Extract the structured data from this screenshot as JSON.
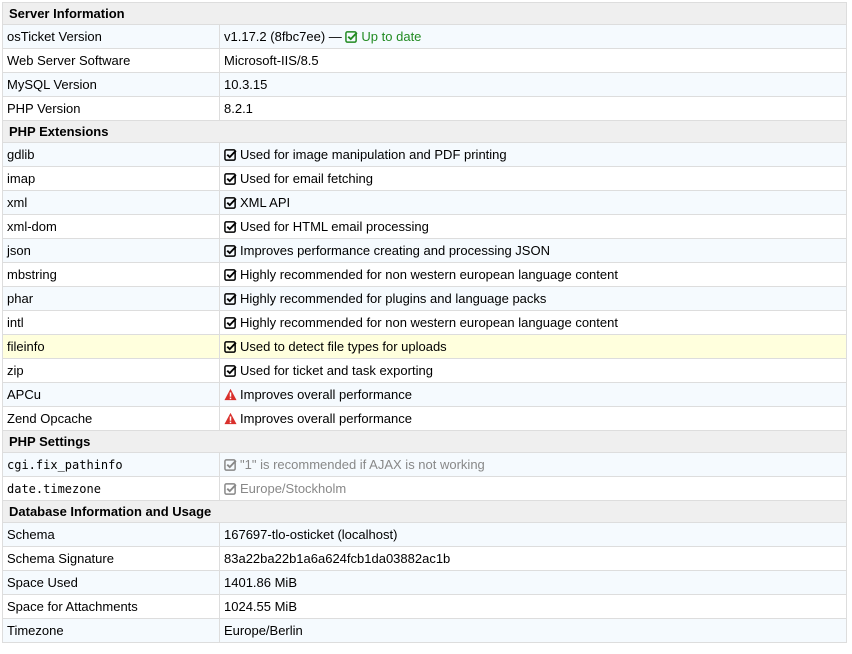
{
  "sections": {
    "server": {
      "title": "Server Information",
      "rows": [
        {
          "label": "osTicket Version",
          "value": "v1.17.2 (8fbc7ee) —",
          "status": "Up to date"
        },
        {
          "label": "Web Server Software",
          "value": "Microsoft-IIS/8.5"
        },
        {
          "label": "MySQL Version",
          "value": "10.3.15"
        },
        {
          "label": "PHP Version",
          "value": "8.2.1"
        }
      ]
    },
    "extensions": {
      "title": "PHP Extensions",
      "rows": [
        {
          "label": "gdlib",
          "value": "Used for image manipulation and PDF printing",
          "icon": "check-square-icon"
        },
        {
          "label": "imap",
          "value": "Used for email fetching",
          "icon": "check-square-icon"
        },
        {
          "label": "xml",
          "value": "XML API",
          "icon": "check-square-icon"
        },
        {
          "label": "xml-dom",
          "value": "Used for HTML email processing",
          "icon": "check-square-icon"
        },
        {
          "label": "json",
          "value": "Improves performance creating and processing JSON",
          "icon": "check-square-icon"
        },
        {
          "label": "mbstring",
          "value": "Highly recommended for non western european language content",
          "icon": "check-square-icon"
        },
        {
          "label": "phar",
          "value": "Highly recommended for plugins and language packs",
          "icon": "check-square-icon"
        },
        {
          "label": "intl",
          "value": "Highly recommended for non western european language content",
          "icon": "check-square-icon"
        },
        {
          "label": "fileinfo",
          "value": "Used to detect file types for uploads",
          "icon": "check-square-icon"
        },
        {
          "label": "zip",
          "value": "Used for ticket and task exporting",
          "icon": "check-square-icon"
        },
        {
          "label": "APCu",
          "value": "Improves overall performance",
          "icon": "warning-icon"
        },
        {
          "label": "Zend Opcache",
          "value": "Improves overall performance",
          "icon": "warning-icon"
        }
      ]
    },
    "settings": {
      "title": "PHP Settings",
      "rows": [
        {
          "label": "cgi.fix_pathinfo",
          "value": "\"1\" is recommended if AJAX is not working",
          "icon": "check-square-icon"
        },
        {
          "label": "date.timezone",
          "value": "Europe/Stockholm",
          "icon": "check-square-icon"
        }
      ]
    },
    "database": {
      "title": "Database Information and Usage",
      "rows": [
        {
          "label": "Schema",
          "value": "167697-tlo-osticket (localhost)"
        },
        {
          "label": "Schema Signature",
          "value": "83a22ba22b1a6a624fcb1da03882ac1b"
        },
        {
          "label": "Space Used",
          "value": "1401.86 MiB"
        },
        {
          "label": "Space for Attachments",
          "value": "1024.55 MiB"
        },
        {
          "label": "Timezone",
          "value": "Europe/Berlin"
        }
      ]
    }
  },
  "colors": {
    "check": "#333333",
    "check_muted": "#888888",
    "warning": "#d9302c",
    "uptodate": "#228b22",
    "highlight_row": "#ffffdd"
  }
}
